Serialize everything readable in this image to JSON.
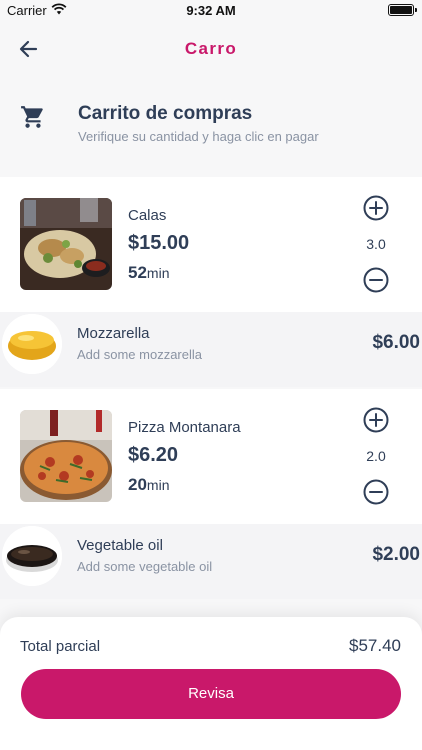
{
  "status_bar": {
    "carrier": "Carrier",
    "time": "9:32 AM"
  },
  "header": {
    "title": "Carro",
    "back_icon": "arrow-left-icon"
  },
  "cart_header": {
    "icon": "shopping-cart-icon",
    "title": "Carrito de compras",
    "subtitle": "Verifique su cantidad y haga clic en pagar"
  },
  "items": [
    {
      "name": "Calas",
      "price": "$15.00",
      "time_value": "52",
      "time_unit": "min",
      "quantity": "3.0"
    },
    {
      "name": "Pizza Montanara",
      "price": "$6.20",
      "time_value": "20",
      "time_unit": "min",
      "quantity": "2.0"
    }
  ],
  "addons": [
    {
      "name": "Mozzarella",
      "description": "Add some mozzarella",
      "price": "$6.00"
    },
    {
      "name": "Vegetable oil",
      "description": "Add some vegetable oil",
      "price": "$2.00"
    }
  ],
  "summary": {
    "subtotal_label": "Total parcial",
    "subtotal_value": "$57.40",
    "checkout_label": "Revisa"
  },
  "colors": {
    "accent": "#c9186a",
    "text": "#2f3e57",
    "muted": "#8a93a3"
  }
}
